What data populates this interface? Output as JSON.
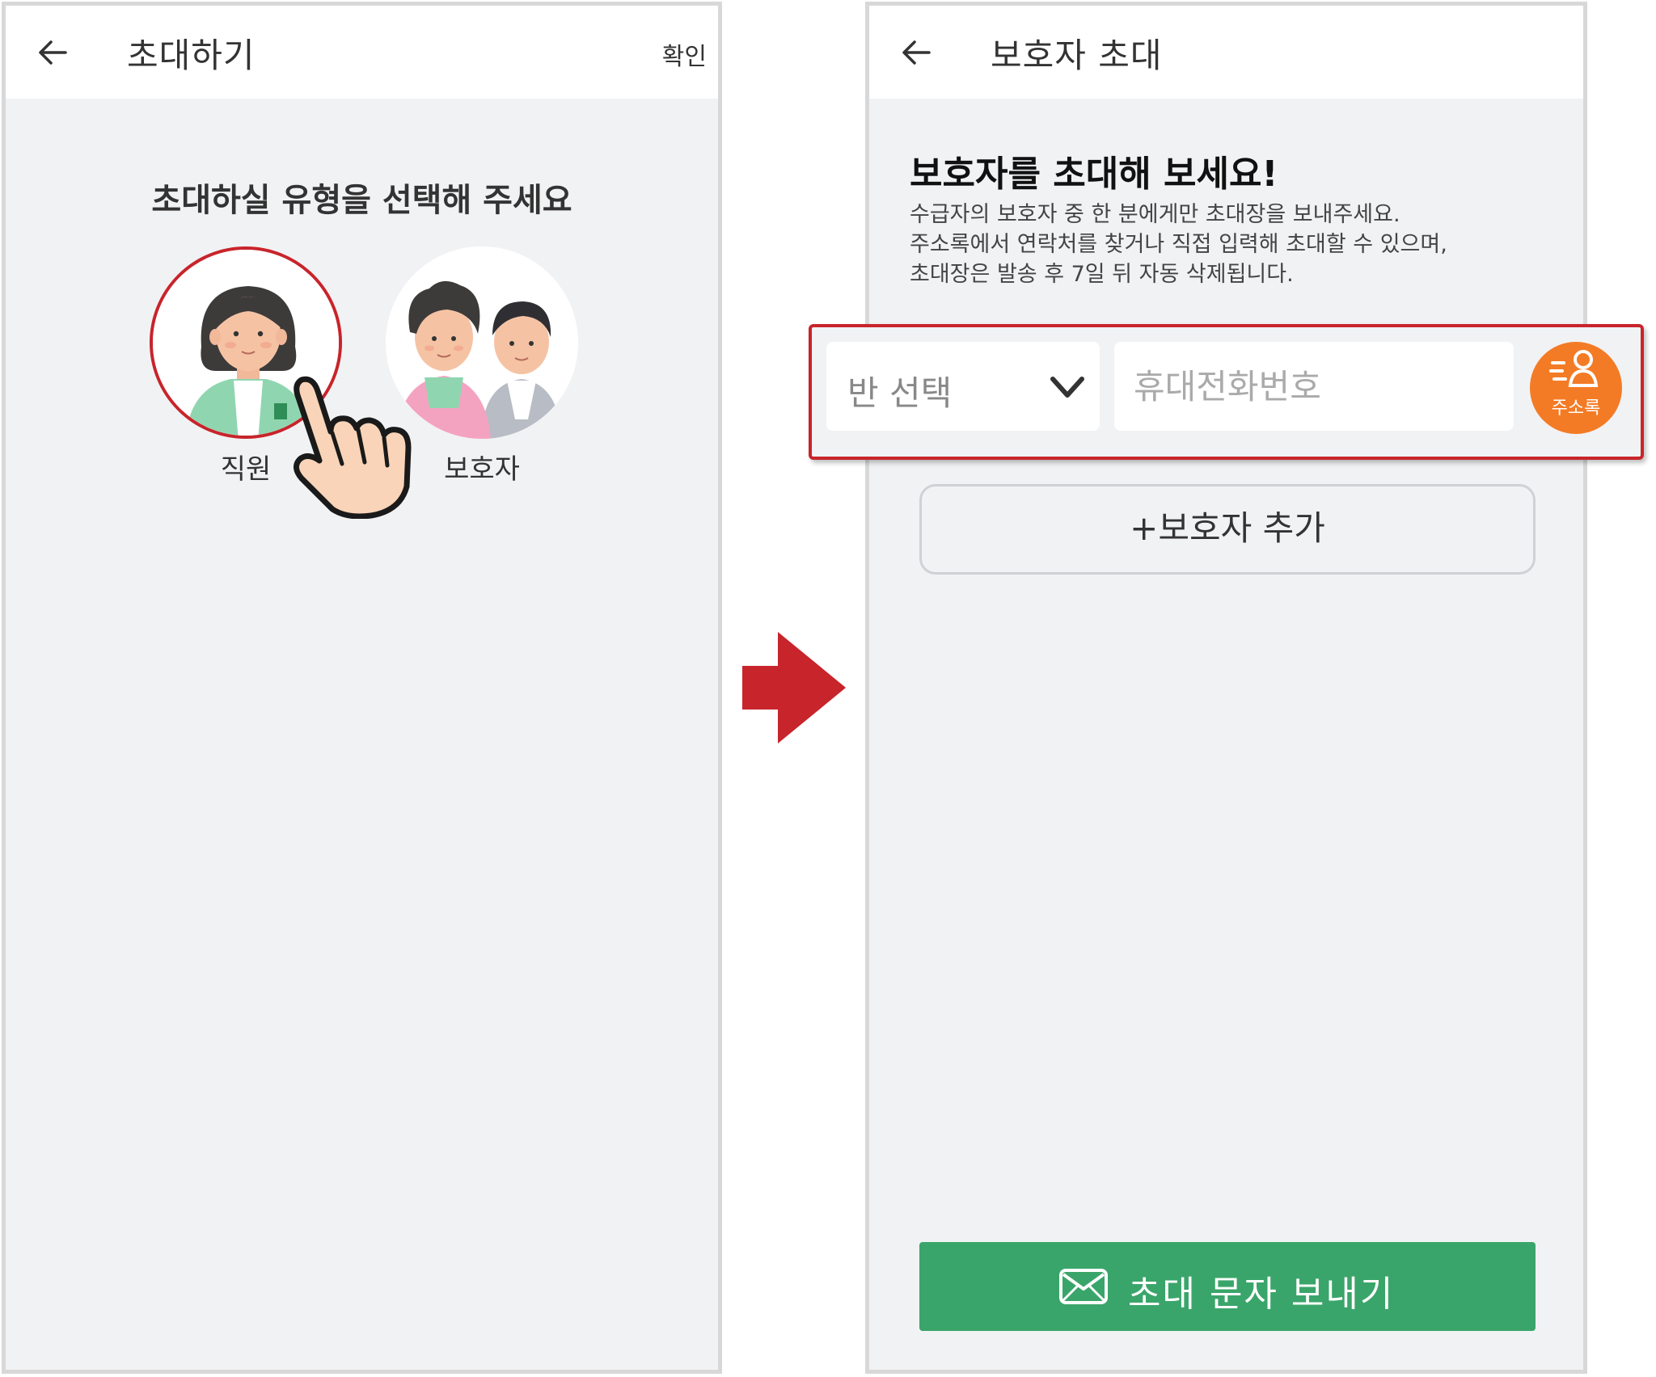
{
  "left_screen": {
    "title": "초대하기",
    "confirm_label": "확인",
    "prompt": "초대하실 유형을 선택해 주세요",
    "options": [
      {
        "label": "직원",
        "selected": true
      },
      {
        "label": "보호자",
        "selected": false
      }
    ]
  },
  "right_screen": {
    "title": "보호자 초대",
    "heading": "보호자를 초대해 보세요!",
    "description": [
      "수급자의 보호자 중 한 분에게만 초대장을 보내주세요.",
      "주소록에서 연락처를 찾거나 직접 입력해 초대할 수 있으며,",
      "초대장은 발송 후 7일 뒤 자동 삭제됩니다."
    ],
    "class_select_label": "반 선택",
    "phone_placeholder": "휴대전화번호",
    "contacts_label": "주소록",
    "add_guardian_label": "+보호자 추가",
    "send_label": "초대 문자 보내기"
  },
  "colors": {
    "highlight": "#c8242b",
    "send_button": "#3aa56a",
    "contacts_button": "#f47b25",
    "background": "#f1f2f4"
  },
  "icons": [
    "back-arrow-icon",
    "chevron-down-icon",
    "contacts-icon",
    "mail-icon",
    "pointer-hand-icon",
    "next-arrow-icon"
  ]
}
